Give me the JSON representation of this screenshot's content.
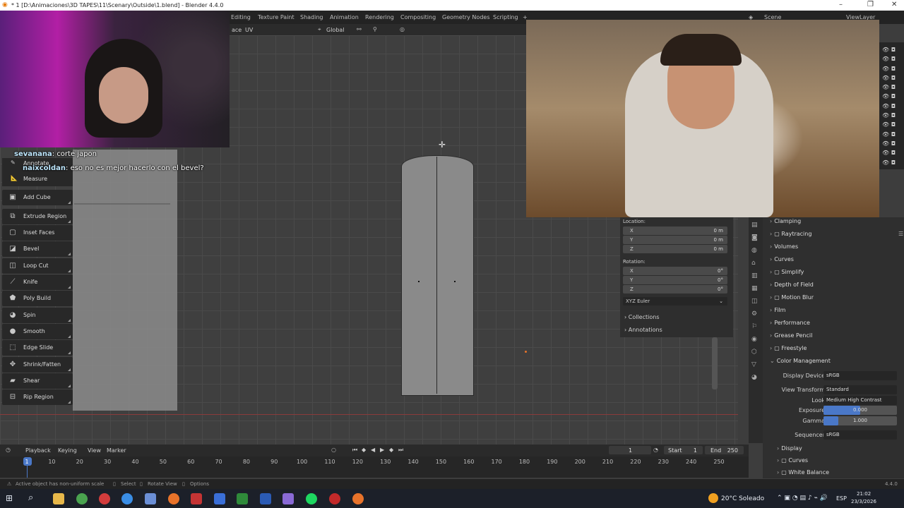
{
  "window": {
    "title": "* 1 [D:\\Animaciones\\3D TAPES\\11\\Scenary\\Outside\\1.blend] - Blender 4.4.0"
  },
  "workspace_tabs": [
    "Editing",
    "Texture Paint",
    "Shading",
    "Animation",
    "Rendering",
    "Compositing",
    "Geometry Nodes",
    "Scripting"
  ],
  "scene": {
    "label": "Scene",
    "view_layer": "ViewLayer"
  },
  "viewport_header": {
    "menu_partial": "ace",
    "uv_menu": "UV",
    "orientation": "Global"
  },
  "chat": [
    {
      "user": "sevanana",
      "message": "corte japon"
    },
    {
      "user": "naixcoldan",
      "message": "eso no es mejor hacerlo con el bevel?"
    }
  ],
  "toolbar": {
    "top_items": [
      "Annotate",
      "Measure"
    ],
    "items": [
      {
        "label": "Add Cube",
        "icon": "cube-icon"
      },
      {
        "label": "Extrude Region",
        "icon": "extrude-icon"
      },
      {
        "label": "Inset Faces",
        "icon": "inset-icon"
      },
      {
        "label": "Bevel",
        "icon": "bevel-icon"
      },
      {
        "label": "Loop Cut",
        "icon": "loop-cut-icon"
      },
      {
        "label": "Knife",
        "icon": "knife-icon"
      },
      {
        "label": "Poly Build",
        "icon": "poly-build-icon"
      },
      {
        "label": "Spin",
        "icon": "spin-icon"
      },
      {
        "label": "Smooth",
        "icon": "smooth-icon"
      },
      {
        "label": "Edge Slide",
        "icon": "edge-slide-icon"
      },
      {
        "label": "Shrink/Fatten",
        "icon": "shrink-fatten-icon"
      },
      {
        "label": "Shear",
        "icon": "shear-icon"
      },
      {
        "label": "Rip Region",
        "icon": "rip-icon"
      }
    ]
  },
  "transform_panel": {
    "location_label": "Location:",
    "location": [
      {
        "axis": "X",
        "value": "0 m"
      },
      {
        "axis": "Y",
        "value": "0 m"
      },
      {
        "axis": "Z",
        "value": "0 m"
      }
    ],
    "rotation_label": "Rotation:",
    "rotation": [
      {
        "axis": "X",
        "value": "0°"
      },
      {
        "axis": "Y",
        "value": "0°"
      },
      {
        "axis": "Z",
        "value": "0°"
      }
    ],
    "rotation_mode": "XYZ Euler",
    "sections": [
      "Collections",
      "Annotations"
    ]
  },
  "properties": {
    "sections": [
      "Clamping",
      "Raytracing",
      "Volumes",
      "Curves",
      "Simplify",
      "Depth of Field",
      "Motion Blur",
      "Film",
      "Performance",
      "Grease Pencil",
      "Freestyle"
    ],
    "color_management": {
      "title": "Color Management",
      "display_device_label": "Display Device",
      "display_device": "sRGB",
      "view_transform_label": "View Transform",
      "view_transform": "Standard",
      "look_label": "Look",
      "look": "Medium High Contrast",
      "exposure_label": "Exposure",
      "exposure": "0.000",
      "exposure_fill": 0.5,
      "gamma_label": "Gamma",
      "gamma": "1.000",
      "gamma_fill": 0.2,
      "sequencer_label": "Sequencer",
      "sequencer": "sRGB",
      "subsections": [
        "Display",
        "Curves",
        "White Balance"
      ]
    }
  },
  "timeline": {
    "menus": [
      "Playback",
      "Keying",
      "View",
      "Marker"
    ],
    "current_frame": "1",
    "start_label": "Start",
    "start": "1",
    "end_label": "End",
    "end": "250",
    "ticks": [
      "1",
      "10",
      "20",
      "30",
      "40",
      "50",
      "60",
      "70",
      "80",
      "90",
      "100",
      "110",
      "120",
      "130",
      "140",
      "150",
      "160",
      "170",
      "180",
      "190",
      "200",
      "210",
      "220",
      "230",
      "240",
      "250"
    ]
  },
  "statusbar": {
    "message": "Active object has non-uniform scale",
    "hints": [
      "Select",
      "Rotate View",
      "Options"
    ],
    "version": "4.4.0"
  },
  "taskbar": {
    "weather": "20°C Soleado",
    "lang": "ESP",
    "time": "21:02",
    "date": "23/3/2026"
  },
  "colors": {
    "accent": "#4a78c8",
    "timeline_marker": "#4a78c8",
    "selection": "#e8732a"
  }
}
